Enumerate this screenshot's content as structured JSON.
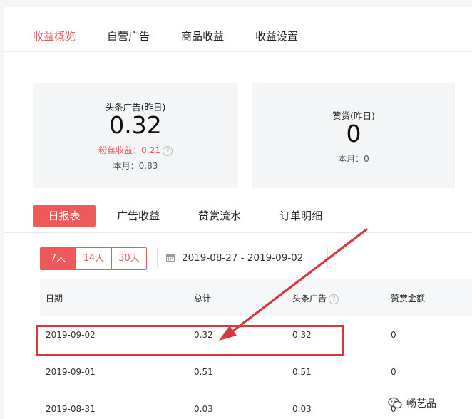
{
  "colors": {
    "accent": "#ee5a5a",
    "accent_text": "#e35d5d",
    "highlight": "#d9363e"
  },
  "topnav": {
    "tabs": [
      {
        "label": "收益概览",
        "active": true
      },
      {
        "label": "自营广告"
      },
      {
        "label": "商品收益"
      },
      {
        "label": "收益设置"
      }
    ]
  },
  "cards": {
    "toutiao": {
      "label": "头条广告(昨日)",
      "value": "0.32",
      "fans_label": "粉丝收益：0.21",
      "month_label": "本月：0.83"
    },
    "reward": {
      "label": "赞赏(昨日)",
      "value": "0",
      "month_label": "本月：0"
    }
  },
  "subnav": {
    "tabs": [
      {
        "label": "日报表",
        "active": true
      },
      {
        "label": "广告收益"
      },
      {
        "label": "赞赏流水"
      },
      {
        "label": "订单明细"
      }
    ]
  },
  "range": {
    "options": [
      {
        "label": "7天",
        "active": true
      },
      {
        "label": "14天"
      },
      {
        "label": "30天"
      }
    ],
    "date_range": "2019-08-27 - 2019-09-02",
    "calendar_icon": "calendar-icon"
  },
  "table": {
    "headers": [
      "日期",
      "总计",
      "头条广告",
      "赞赏金额"
    ],
    "help_icon": "question-circle-icon",
    "rows": [
      [
        "2019-09-02",
        "0.32",
        "0.32",
        "0"
      ],
      [
        "2019-09-01",
        "0.51",
        "0.51",
        "0"
      ],
      [
        "2019-08-31",
        "0.03",
        "0.03",
        "0"
      ]
    ]
  },
  "watermark": {
    "text": "畅艺品",
    "icon": "wechat-icon"
  }
}
